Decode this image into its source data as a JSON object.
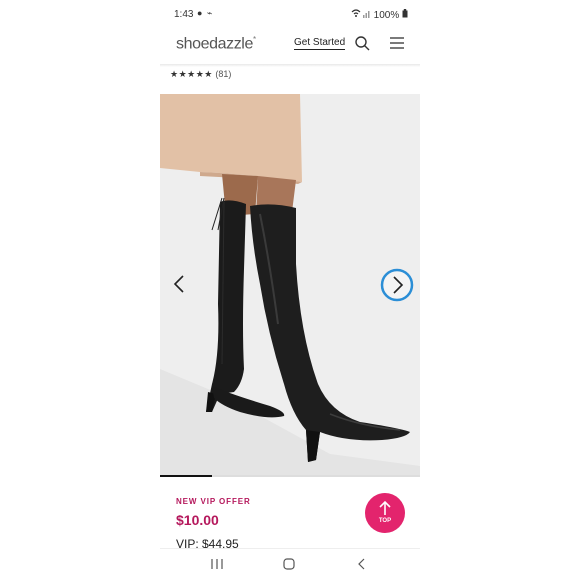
{
  "status_bar": {
    "time": "1:43",
    "left_icons": "● ⌁",
    "battery": "100%"
  },
  "header": {
    "logo": "shoedazzle",
    "logo_mark": "*",
    "get_started": "Get Started"
  },
  "rating": {
    "stars": "★★★★★",
    "count": "(81)"
  },
  "carousel": {
    "current_slide_fraction": 0.2
  },
  "offer": {
    "label": "NEW VIP OFFER",
    "price": "$10.00",
    "vip_price": "VIP: $44.95"
  },
  "back_to_top": {
    "label": "TOP"
  },
  "colors": {
    "accent_magenta": "#b5185c",
    "top_button": "#e3246d",
    "carousel_ring": "#2b8ed6"
  }
}
